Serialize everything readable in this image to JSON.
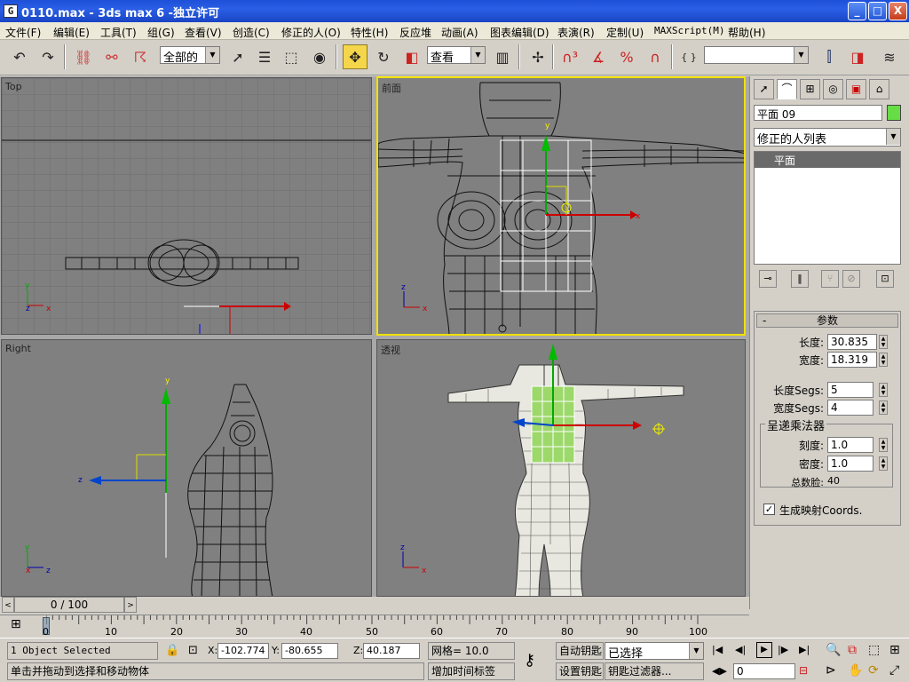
{
  "window": {
    "title": "0110.max - 3ds max 6 -独立许可",
    "min": "_",
    "max": "□",
    "close": "X",
    "app_icon": "G"
  },
  "menu": [
    "文件(F)",
    "编辑(E)",
    "工具(T)",
    "组(G)",
    "查看(V)",
    "创造(C)",
    "修正的人(O)",
    "特性(H)",
    "反应堆",
    "动画(A)",
    "图表编辑(D)",
    "表演(R)",
    "定制(U)",
    "MAXScript(M)",
    "帮助(H)"
  ],
  "toolbar": {
    "selection_filter": "全部的",
    "ref_coord": "查看",
    "icons": [
      "undo-icon",
      "redo-icon",
      "select-link-icon",
      "unlink-icon",
      "bind-spacewarp-icon",
      "select-object-icon",
      "select-by-name-icon",
      "rect-region-icon",
      "window-crossing-icon",
      "move-icon",
      "rotate-icon",
      "scale-icon",
      "pivot-icon",
      "manipulate-icon",
      "snap-3d-icon",
      "angle-snap-icon",
      "percent-snap-icon",
      "spinner-snap-icon",
      "named-selection-icon",
      "mirror-icon",
      "align-icon",
      "layers-icon"
    ]
  },
  "viewports": [
    {
      "id": "top",
      "label": "Top"
    },
    {
      "id": "front",
      "label": "前面"
    },
    {
      "id": "right",
      "label": "Right"
    },
    {
      "id": "persp",
      "label": "透视"
    }
  ],
  "command_panel": {
    "object_name": "平面 09",
    "object_color": "#66dd44",
    "modifier_list": "修正的人列表",
    "stack_item": "平面",
    "rollout_title": "参数",
    "params": [
      {
        "label": "长度:",
        "value": "30.835"
      },
      {
        "label": "宽度:",
        "value": "18.319"
      },
      {
        "label": "长度Segs:",
        "value": "5"
      },
      {
        "label": "宽度Segs:",
        "value": "4"
      }
    ],
    "render_group": "呈递乘法器",
    "render_params": [
      {
        "label": "刻度:",
        "value": "1.0"
      },
      {
        "label": "密度:",
        "value": "1.0"
      }
    ],
    "total_faces_label": "总数脸:",
    "total_faces": "40",
    "gen_coords": "生成映射Coords."
  },
  "time": {
    "slider": "0 / 100",
    "ticks": [
      "0",
      "10",
      "20",
      "30",
      "40",
      "50",
      "60",
      "70",
      "80",
      "90",
      "100"
    ]
  },
  "status": {
    "selected": "1 Object Selected",
    "prompt": "单击并拖动到选择和移动物体",
    "x_label": "X:",
    "x": "-102.774",
    "y_label": "Y:",
    "y": "-80.655",
    "z_label": "Z:",
    "z": "40.187",
    "grid": "网格= 10.0",
    "add_time_tag": "增加时间标签",
    "auto_key": "自动钥匙",
    "set_key": "设置钥匙",
    "selected_combo": "已选择",
    "key_filters": "钥匙过滤器...",
    "frame": "0"
  },
  "axis": {
    "x": "x",
    "y": "y",
    "z": "z"
  }
}
